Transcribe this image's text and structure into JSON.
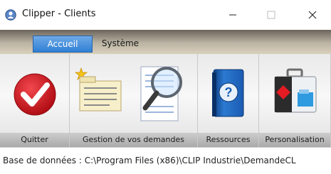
{
  "window": {
    "title": "Clipper - Clients"
  },
  "window_controls": [
    "minimize",
    "maximize",
    "close"
  ],
  "tabs": [
    {
      "label": "Accueil",
      "active": true
    },
    {
      "label": "Système",
      "active": false
    }
  ],
  "ribbon_groups": [
    {
      "label": "Quitter",
      "icon": "check-icon"
    },
    {
      "label": "Gestion de vos demandes",
      "icon": "search-documents-icon"
    },
    {
      "label": "Ressources",
      "icon": "help-book-icon"
    },
    {
      "label": "Personalisation",
      "icon": "toolbox-icon"
    }
  ],
  "status": {
    "text": "Base de données : C:\\Program Files (x86)\\CLIP Industrie\\DemandeCL"
  },
  "colors": {
    "accent_tab": "#2f7fd4",
    "quit_red": "#d71920",
    "help_blue": "#1f6fc4"
  }
}
